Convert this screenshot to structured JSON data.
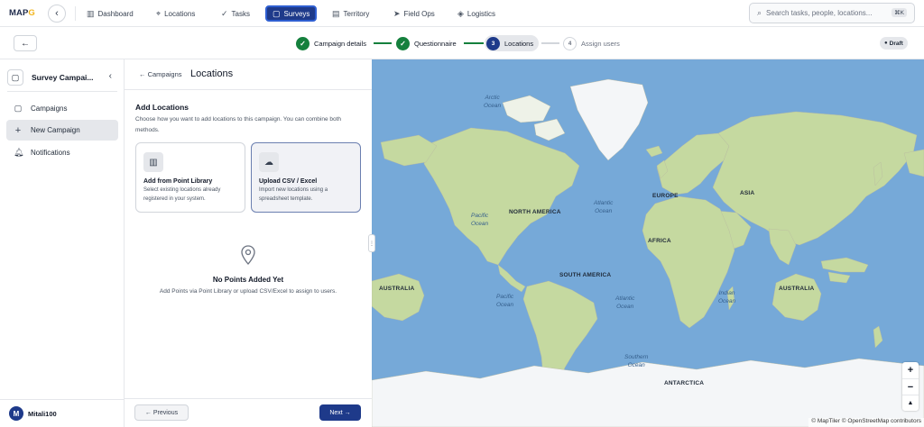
{
  "topnav": {
    "logo_main": "MAP",
    "logo_accent": "G",
    "logo_tail": "",
    "items": [
      {
        "label": "Dashboard",
        "icon": "bar-chart-icon"
      },
      {
        "label": "Locations",
        "icon": "map-pin-icon"
      },
      {
        "label": "Tasks",
        "icon": "check-list-icon"
      },
      {
        "label": "Surveys",
        "icon": "clipboard-icon",
        "active": true
      },
      {
        "label": "Territory",
        "icon": "map-icon"
      },
      {
        "label": "Field Ops",
        "icon": "send-icon"
      },
      {
        "label": "Logistics",
        "icon": "box-icon"
      }
    ],
    "search_placeholder": "Search tasks, people, locations...",
    "search_shortcut": "⌘K"
  },
  "stepper": {
    "steps": [
      {
        "label": "Campaign details",
        "state": "done"
      },
      {
        "label": "Questionnaire",
        "state": "done"
      },
      {
        "label": "Locations",
        "state": "current",
        "number": "3"
      },
      {
        "label": "Assign users",
        "state": "todo",
        "number": "4"
      }
    ],
    "status_badge": "Draft"
  },
  "sidebar": {
    "title": "Survey Campai...",
    "items": [
      {
        "label": "Campaigns",
        "icon": "clipboard-icon"
      },
      {
        "label": "New Campaign",
        "icon": "plus-icon",
        "active": true
      },
      {
        "label": "Notifications",
        "icon": "bell-icon"
      }
    ],
    "user": {
      "initial": "M",
      "name": "Mitali100"
    }
  },
  "panel": {
    "breadcrumb": "← Campaigns",
    "title": "Locations",
    "section_title": "Add Locations",
    "section_desc": "Choose how you want to add locations to this campaign. You can combine both methods.",
    "cards": [
      {
        "title": "Add from Point Library",
        "desc": "Select existing locations already registered in your system.",
        "icon": "library-icon"
      },
      {
        "title": "Upload CSV / Excel",
        "desc": "Import new locations using a spreadsheet template.",
        "icon": "cloud-upload-icon",
        "selected": true
      }
    ],
    "empty_title": "No Points Added Yet",
    "empty_desc": "Add Points via Point Library or upload CSV/Excel to assign to users.",
    "prev_label": "← Previous",
    "next_label": "Next →"
  },
  "map": {
    "oceans": [
      {
        "l1": "Arctic",
        "l2": "Ocean"
      },
      {
        "l1": "Atlantic",
        "l2": "Ocean"
      },
      {
        "l1": "Pacific",
        "l2": "Ocean"
      },
      {
        "l1": "Pacific",
        "l2": "Ocean"
      },
      {
        "l1": "Atlantic",
        "l2": "Ocean"
      },
      {
        "l1": "Indian",
        "l2": "Ocean"
      },
      {
        "l1": "Southern",
        "l2": "Ocean"
      }
    ],
    "continents": [
      "NORTH AMERICA",
      "EUROPE",
      "ASIA",
      "AFRICA",
      "SOUTH AMERICA",
      "AUSTRALIA",
      "AUSTRALIA",
      "ANTARCTICA"
    ],
    "zoom_in": "+",
    "zoom_out": "−",
    "compass": "▲",
    "attribution": "© MapTiler © OpenStreetMap contributors"
  }
}
